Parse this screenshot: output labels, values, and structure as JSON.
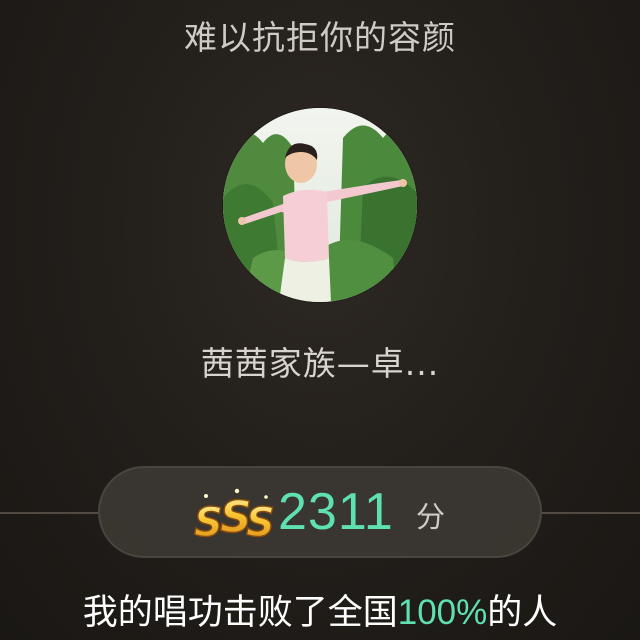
{
  "song": {
    "title": "难以抗拒你的容颜"
  },
  "singer": {
    "name": "茜茜家族—卓..."
  },
  "score": {
    "grade": "SSS",
    "value": "2311",
    "unit": "分"
  },
  "result": {
    "prefix": "我的唱功击败了全国",
    "percent": "100%",
    "suffix": "的人"
  },
  "colors": {
    "accent": "#5fe0b0",
    "grade_gold": "#f5b82e",
    "background": "#231f1b"
  }
}
